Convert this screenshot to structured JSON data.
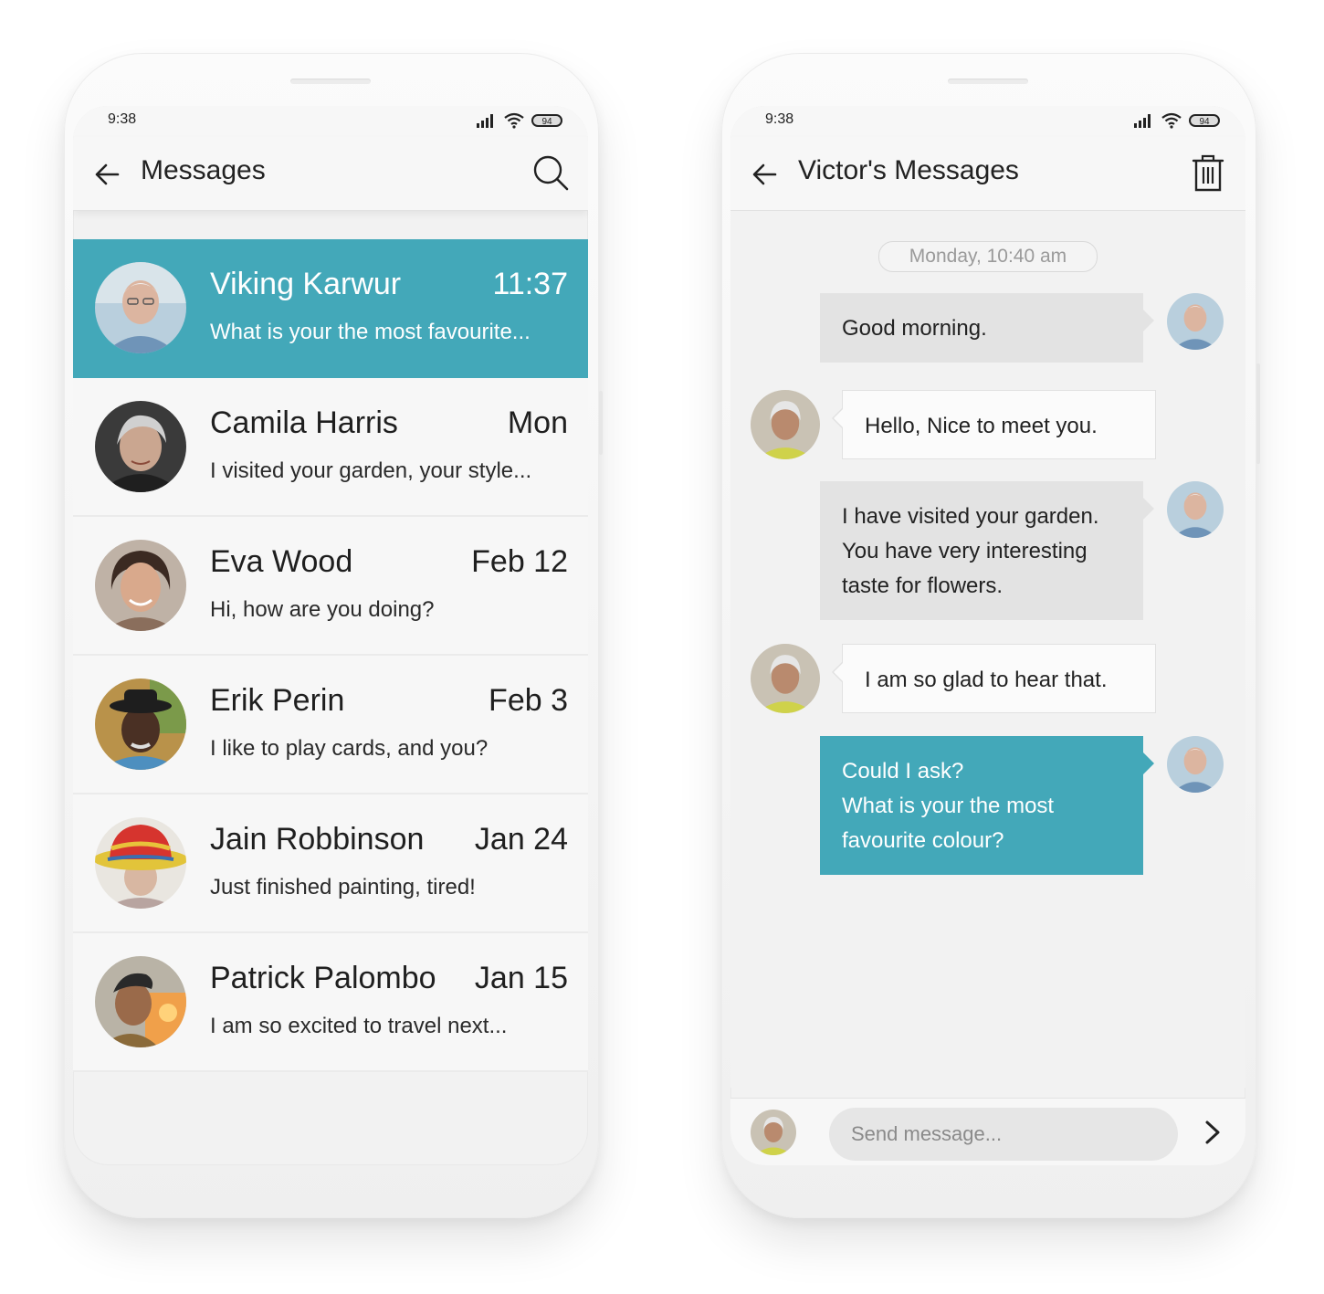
{
  "left_phone": {
    "status": {
      "time": "9:38",
      "battery": "94"
    },
    "appbar": {
      "title": "Messages",
      "back_icon": "arrow-left-icon",
      "action_icon": "search-icon"
    },
    "conversations": [
      {
        "name": "Viking Karwur",
        "time": "11:37",
        "preview": "What is your the most favourite...",
        "active": true
      },
      {
        "name": "Camila Harris",
        "time": "Mon",
        "preview": "I visited your garden, your style..."
      },
      {
        "name": "Eva Wood",
        "time": "Feb 12",
        "preview": "Hi, how are you doing?"
      },
      {
        "name": "Erik Perin",
        "time": "Feb 3",
        "preview": "I like to play cards, and you?"
      },
      {
        "name": "Jain Robbinson",
        "time": "Jan 24",
        "preview": "Just finished painting, tired!"
      },
      {
        "name": "Patrick Palombo",
        "time": "Jan 15",
        "preview": "I am so excited to travel next..."
      }
    ]
  },
  "right_phone": {
    "status": {
      "time": "9:38",
      "battery": "94"
    },
    "appbar": {
      "title": "Victor's Messages",
      "back_icon": "arrow-left-icon",
      "action_icon": "trash-icon"
    },
    "date_separator": "Monday, 10:40 am",
    "messages": [
      {
        "from": "me",
        "lines": [
          "Good morning."
        ]
      },
      {
        "from": "them",
        "lines": [
          "Hello, Nice to meet you."
        ]
      },
      {
        "from": "me",
        "lines": [
          "I have visited your garden.",
          "You have very interesting",
          "taste for flowers."
        ]
      },
      {
        "from": "them",
        "lines": [
          "I am so glad to hear that."
        ]
      },
      {
        "from": "me",
        "lines": [
          "Could I ask?",
          "What is your the most",
          "favourite colour?"
        ],
        "highlight": true
      }
    ],
    "composer": {
      "placeholder": "Send message...",
      "value": "",
      "send_icon": "chevron-right-icon"
    }
  },
  "colors": {
    "accent": "#43a8b9",
    "my_bubble": "#e3e3e3",
    "their_bubble": "#fbfbfb",
    "date_text": "#9a9a9a"
  }
}
